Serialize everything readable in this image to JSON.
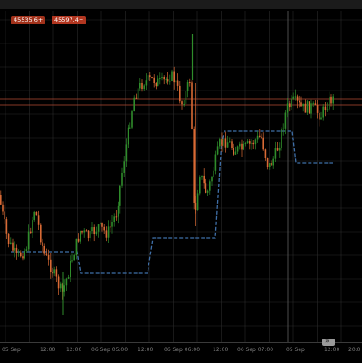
{
  "price_badges": [
    {
      "label": "45535.6+"
    },
    {
      "label": "45597.4+"
    }
  ],
  "x_axis": {
    "ticks": [
      {
        "label": "05 Sep"
      },
      {
        "label": "12:00"
      },
      {
        "label": "12:00"
      },
      {
        "label": "06 Sep 05:00"
      },
      {
        "label": "12:00"
      },
      {
        "label": "06 Sep 06:00"
      },
      {
        "label": "12:00"
      },
      {
        "label": "06 Sep 07:00"
      },
      {
        "label": "05 Sep"
      },
      {
        "label": "12:00"
      },
      {
        "label": "20:0"
      }
    ]
  },
  "colors": {
    "up": "#2f8c2b",
    "down": "#d86a35",
    "step_line": "#3f6fa8",
    "price_line": "#b34a33",
    "grid": "#2b2b2b",
    "cursor_line": "#606060"
  },
  "icons": {
    "scroll_to_latest": "double-chevron-right-icon"
  }
}
